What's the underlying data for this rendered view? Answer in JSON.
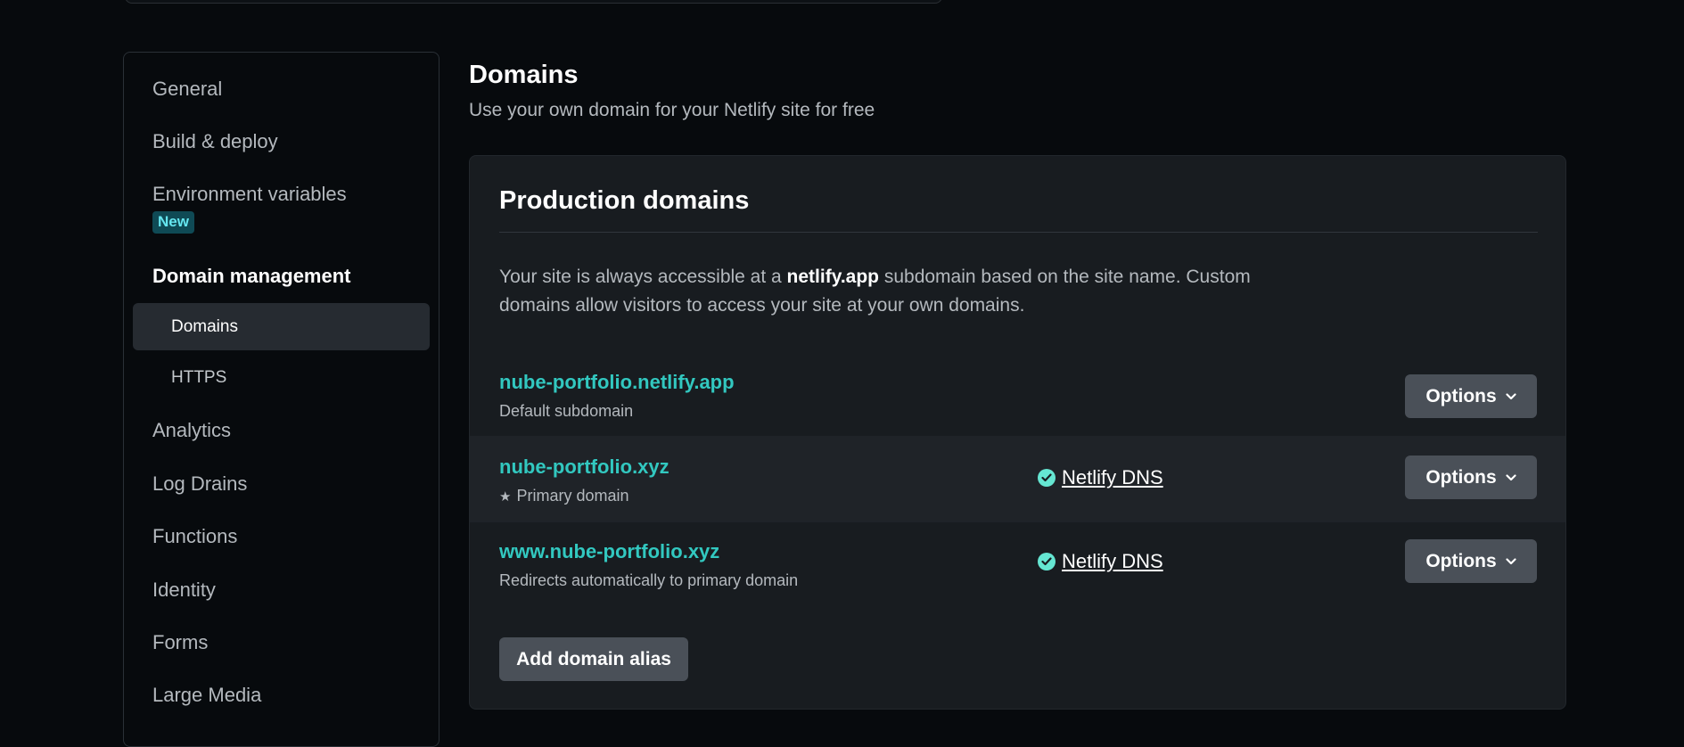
{
  "sidebar": {
    "items": [
      {
        "label": "General"
      },
      {
        "label": "Build & deploy"
      },
      {
        "label": "Environment variables",
        "badge": "New"
      },
      {
        "label": "Domain management",
        "active": true
      },
      {
        "label": "Analytics"
      },
      {
        "label": "Log Drains"
      },
      {
        "label": "Functions"
      },
      {
        "label": "Identity"
      },
      {
        "label": "Forms"
      },
      {
        "label": "Large Media"
      }
    ],
    "sub_items": [
      {
        "label": "Domains",
        "selected": true
      },
      {
        "label": "HTTPS"
      }
    ]
  },
  "main": {
    "title": "Domains",
    "subtitle": "Use your own domain for your Netlify site for free",
    "card": {
      "title": "Production domains",
      "desc_part1": "Your site is always accessible at a ",
      "desc_bold": "netlify.app",
      "desc_part2": " subdomain based on the site name. Custom domains allow visitors to access your site at your own domains.",
      "domains": [
        {
          "name": "nube-portfolio.netlify.app",
          "sub": "Default subdomain",
          "dns": "",
          "options": "Options"
        },
        {
          "name": "nube-portfolio.xyz",
          "sub": "Primary domain",
          "dns": "Netlify DNS",
          "options": "Options"
        },
        {
          "name": "www.nube-portfolio.xyz",
          "sub": "Redirects automatically to primary domain",
          "dns": "Netlify DNS",
          "options": "Options"
        }
      ],
      "add_alias_label": "Add domain alias"
    }
  },
  "colors": {
    "background": "#070a0d",
    "card": "#181c20",
    "accent_teal": "#32c8c0",
    "check": "#65e6d2",
    "button": "#4a5058"
  }
}
